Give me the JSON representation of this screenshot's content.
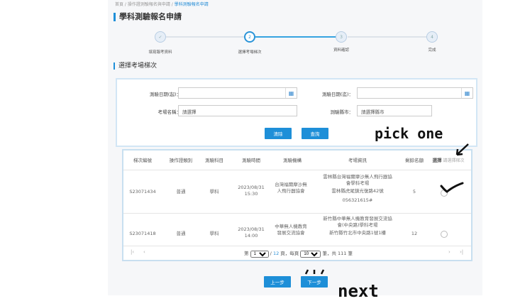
{
  "breadcrumb": [
    "首頁",
    "操作證測驗報名與申請",
    "學科測驗報名申請"
  ],
  "page_title": "學科測驗報名申請",
  "steps": [
    {
      "label": "填寫報考資料",
      "mark": "✓"
    },
    {
      "label": "選擇考場梯次",
      "mark": "2"
    },
    {
      "label": "資料確認",
      "mark": "3"
    },
    {
      "label": "完成",
      "mark": "4"
    }
  ],
  "current_step": 2,
  "section_title": "選擇考場梯次",
  "search": {
    "date_from_label": "測驗日期(起)：",
    "date_from_value": "",
    "date_to_label": "測驗日期(迄)：",
    "date_to_value": "",
    "venue_label": "考場名稱：",
    "venue_value": "請選擇",
    "city_label": "測驗縣市：",
    "city_value": "請選擇縣市",
    "clear_label": "清除",
    "query_label": "查詢"
  },
  "table": {
    "headers": [
      "梯次編號",
      "操作證類別",
      "測驗科目",
      "測驗時間",
      "測驗機構",
      "考場資訊",
      "剩餘名額",
      "選擇"
    ],
    "select_hint": "請選擇梯次",
    "rows": [
      {
        "id": "S23071434",
        "type": "普通",
        "subject": "學科",
        "date": "2023/08/31",
        "time": "15:30",
        "org": "台灣福爾摩沙無人飛行器協會",
        "venue": "雲林縣台灣福爾摩沙無人飛行器協會學科考場",
        "address": "雲林縣虎尾鎮光復路42號",
        "phone": "056321615#",
        "seats": "5"
      },
      {
        "id": "S23071418",
        "type": "普通",
        "subject": "學科",
        "date": "2023/08/31",
        "time": "14:00",
        "org": "中華無人機教育發展交流協會",
        "venue": "新竹縣中華無人機教育發展交流協會(中央路)學科考場",
        "address": "新竹縣竹北市中央路1號1樓",
        "phone": "",
        "seats": "12"
      }
    ],
    "pagination": {
      "prefix": "第",
      "page": "1",
      "sep": "/",
      "total_pages": "12",
      "page_unit": "頁，每頁",
      "per_page": "10",
      "per_unit": "筆，共",
      "total": "111",
      "total_unit": "筆"
    }
  },
  "prev_label": "上一步",
  "next_label": "下一步",
  "annotations": {
    "pick": "pick one",
    "next": "next"
  }
}
